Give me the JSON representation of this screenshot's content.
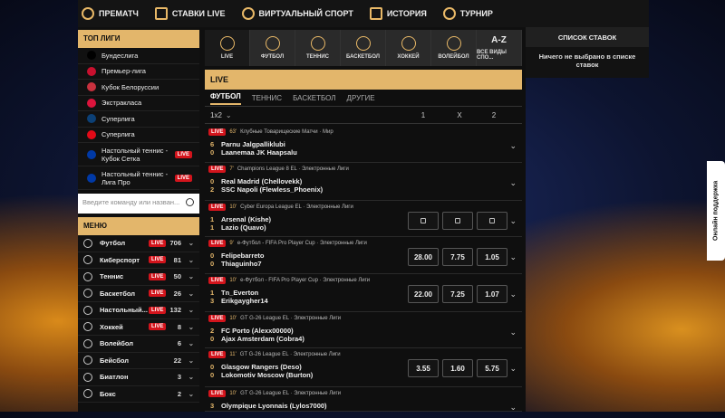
{
  "nav": [
    {
      "label": "ПРЕМАТЧ",
      "icon": "globe-icon"
    },
    {
      "label": "СТАВКИ LIVE",
      "icon": "live-tv-icon"
    },
    {
      "label": "ВИРТУАЛЬНЫЙ СПОРТ",
      "icon": "runner-icon"
    },
    {
      "label": "ИСТОРИЯ",
      "icon": "history-icon"
    },
    {
      "label": "ТУРНИР",
      "icon": "trophy-icon"
    }
  ],
  "top_leagues": {
    "title": "ТОП ЛИГИ",
    "items": [
      {
        "label": "Бундеслига",
        "flag": "#000000"
      },
      {
        "label": "Премьер-лига",
        "flag": "#c8102e"
      },
      {
        "label": "Кубок Белоруссии",
        "flag": "#c8313e"
      },
      {
        "label": "Экстракласа",
        "flag": "#dc143c"
      },
      {
        "label": "Суперлига",
        "flag": "#0c4076"
      },
      {
        "label": "Суперлига",
        "flag": "#e30a17"
      },
      {
        "label": "Настольный теннис - Кубок Сетка",
        "flag": "#0039a6",
        "live": "LIVE"
      },
      {
        "label": "Настольный теннис - Лига Про",
        "flag": "#0039a6",
        "live": "LIVE"
      }
    ]
  },
  "search": {
    "placeholder": "Введите команду или назван..."
  },
  "menu": {
    "title": "МЕНЮ",
    "items": [
      {
        "label": "Футбол",
        "live": "LIVE",
        "count": "706"
      },
      {
        "label": "Киберспорт",
        "live": "LIVE",
        "count": "81"
      },
      {
        "label": "Теннис",
        "live": "LIVE",
        "count": "50"
      },
      {
        "label": "Баскетбол",
        "live": "LIVE",
        "count": "26"
      },
      {
        "label": "Настольный...",
        "live": "LIVE",
        "count": "132"
      },
      {
        "label": "Хоккей",
        "live": "LIVE",
        "count": "8"
      },
      {
        "label": "Волейбол",
        "live": "",
        "count": "6"
      },
      {
        "label": "Бейсбол",
        "live": "",
        "count": "22"
      },
      {
        "label": "Биатлон",
        "live": "",
        "count": "3"
      },
      {
        "label": "Бокс",
        "live": "",
        "count": "2"
      }
    ]
  },
  "categories": [
    {
      "label": "LIVE"
    },
    {
      "label": "ФУТБОЛ"
    },
    {
      "label": "ТЕННИС"
    },
    {
      "label": "БАСКЕТБОЛ"
    },
    {
      "label": "ХОККЕЙ"
    },
    {
      "label": "ВОЛЕЙБОЛ"
    },
    {
      "label": "ВСЕ ВИДЫ СПО...",
      "top": "A-Z"
    }
  ],
  "live_title": "LIVE",
  "sport_tabs": [
    "ФУТБОЛ",
    "ТЕННИС",
    "БАСКЕТБОЛ",
    "ДРУГИЕ"
  ],
  "odds_header": {
    "market": "1x2",
    "c1": "1",
    "cx": "X",
    "c2": "2"
  },
  "live_badge": "LIVE",
  "events": [
    {
      "time": "63'",
      "league": "Клубные Товарищеские Матчи · Мир",
      "s1": "6",
      "t1": "Parnu Jalgpalliklubi",
      "s2": "0",
      "t2": "Laanemaa JK Haapsalu",
      "odds": []
    },
    {
      "time": "7'",
      "league": "Champions League 8 EL · Электронные Лиги",
      "s1": "0",
      "t1": "Real Madrid (Chellovekk)",
      "s2": "2",
      "t2": "SSC Napoli (Flewless_Phoenix)",
      "odds": []
    },
    {
      "time": "10'",
      "league": "Cyber Europa League EL · Электронные Лиги",
      "s1": "1",
      "t1": "Arsenal (Kishe)",
      "s2": "1",
      "t2": "Lazio (Quavo)",
      "odds": [
        "lock",
        "lock",
        "lock"
      ]
    },
    {
      "time": "9'",
      "league": "e-Футбол - FIFA Pro Player Cup · Электронные Лиги",
      "s1": "0",
      "t1": "Felipebarreto",
      "s2": "0",
      "t2": "Thiaguinho7",
      "odds": [
        "28.00",
        "7.75",
        "1.05"
      ]
    },
    {
      "time": "10'",
      "league": "e-Футбол - FIFA Pro Player Cup · Электронные Лиги",
      "s1": "1",
      "t1": "Tn_Everton",
      "s2": "3",
      "t2": "Erikgaygher14",
      "odds": [
        "22.00",
        "7.25",
        "1.07"
      ]
    },
    {
      "time": "10'",
      "league": "GT G-26 League EL · Электронные Лиги",
      "s1": "2",
      "t1": "FC Porto (Alexx00000)",
      "s2": "0",
      "t2": "Ajax Amsterdam (Cobra4)",
      "odds": []
    },
    {
      "time": "11'",
      "league": "GT G-26 League EL · Электронные Лиги",
      "s1": "0",
      "t1": "Glasgow Rangers (Deso)",
      "s2": "0",
      "t2": "Lokomotiv Moscow (Burton)",
      "odds": [
        "3.55",
        "1.60",
        "5.75"
      ]
    },
    {
      "time": "10'",
      "league": "GT G-26 League EL · Электронные Лиги",
      "s1": "3",
      "t1": "Olympique Lyonnais (Lylos7000)",
      "s2": "",
      "t2": "",
      "odds": []
    }
  ],
  "betslip": {
    "title": "СПИСОК СТАВОК",
    "empty": "Ничего не выбрано в списке ставок"
  },
  "support": "Онлайн поддержка"
}
